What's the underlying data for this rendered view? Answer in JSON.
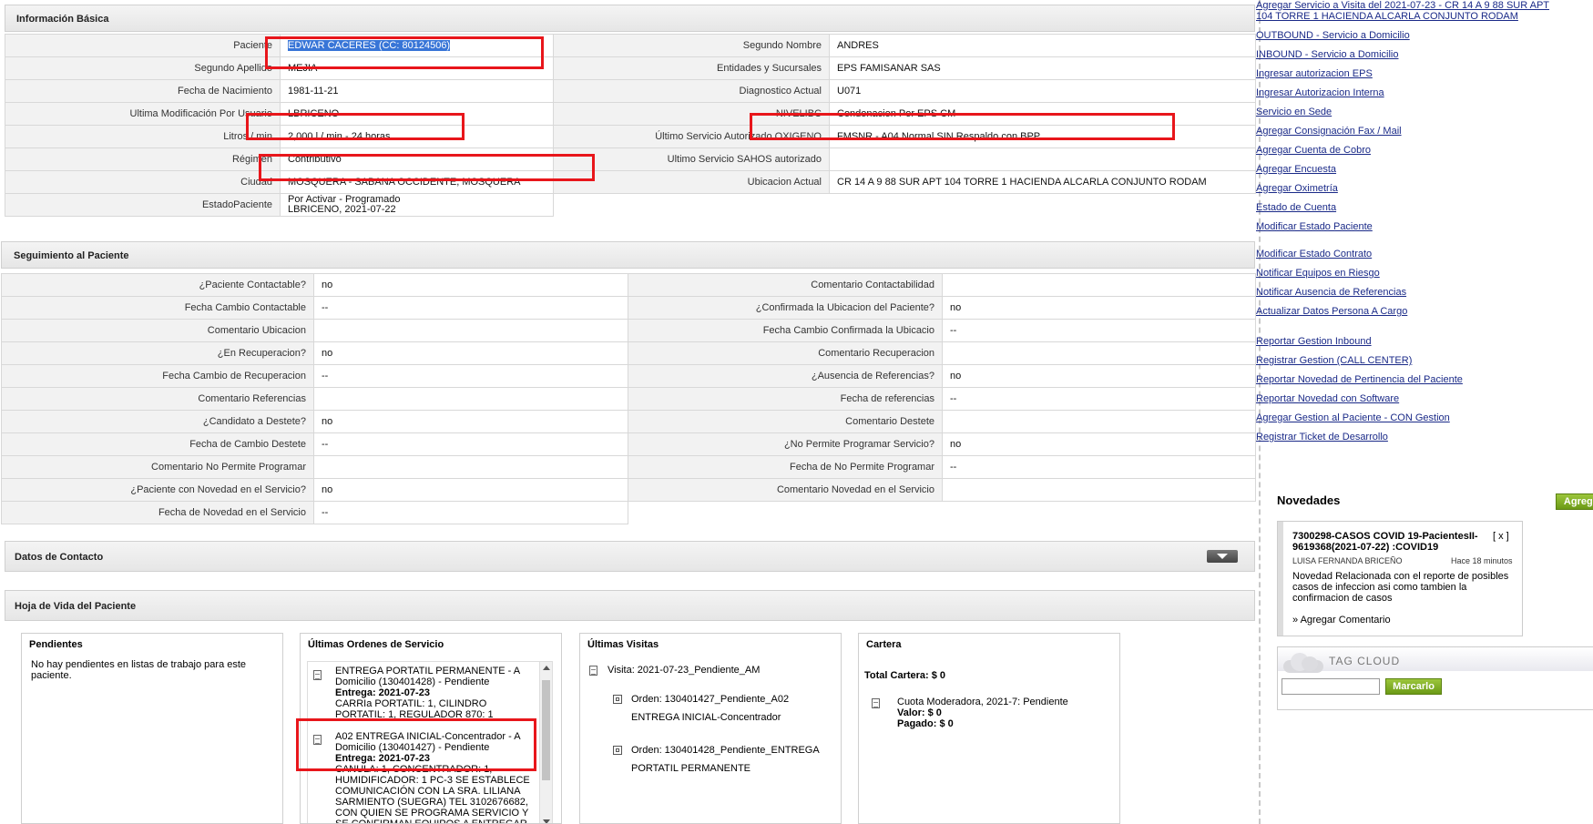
{
  "basic": {
    "header": "Información Básica",
    "rows": [
      {
        "l1": "Paciente",
        "v1": "EDWAR CACERES (CC: 80124506)",
        "l2": "Segundo Nombre",
        "v2": "ANDRES"
      },
      {
        "l1": "Segundo Apellido",
        "v1": "MEJIA",
        "l2": "Entidades y Sucursales",
        "v2": "EPS FAMISANAR SAS"
      },
      {
        "l1": "Fecha de Nacimiento",
        "v1": "1981-11-21",
        "l2": "Diagnostico Actual",
        "v2": "U071"
      },
      {
        "l1": "Ultima Modificación Por Usuario",
        "v1": "LBRICENO",
        "l2": "NIVELIBC",
        "v2": "Condonacion Por EPS CM"
      },
      {
        "l1": "Litros / min",
        "v1": "2,000 l / min - 24 horas",
        "l2": "Último Servicio Autorizado OXIGENO",
        "v2": "FMSNR - A04 Normal SIN Respaldo con BPP"
      },
      {
        "l1": "Régimen",
        "v1": "Contributivo",
        "l2": "Ultimo Servicio SAHOS autorizado",
        "v2": ""
      },
      {
        "l1": "Ciudad",
        "v1": "MOSQUERA - SABANA OCCIDENTE, MOSQUERA",
        "l2": "Ubicacion Actual",
        "v2": "CR 14 A 9 88 SUR APT 104 TORRE 1 HACIENDA ALCARLA CONJUNTO RODAM"
      }
    ],
    "estado_label": "EstadoPaciente",
    "estado_line1": "Por Activar - Programado",
    "estado_line2": "LBRICENO, 2021-07-22"
  },
  "seguimiento": {
    "header": "Seguimiento al Paciente",
    "rows": [
      {
        "l1": "¿Paciente Contactable?",
        "v1": "no",
        "l2": "Comentario Contactabilidad",
        "v2": ""
      },
      {
        "l1": "Fecha Cambio Contactable",
        "v1": "--",
        "l2": "¿Confirmada la Ubicacion del Paciente?",
        "v2": "no"
      },
      {
        "l1": "Comentario Ubicacion",
        "v1": "",
        "l2": "Fecha Cambio Confirmada la Ubicacio",
        "v2": "--"
      },
      {
        "l1": "¿En Recuperacion?",
        "v1": "no",
        "l2": "Comentario Recuperacion",
        "v2": ""
      },
      {
        "l1": "Fecha Cambio de Recuperacion",
        "v1": "--",
        "l2": "¿Ausencia de Referencias?",
        "v2": "no"
      },
      {
        "l1": "Comentario Referencias",
        "v1": "",
        "l2": "Fecha de referencias",
        "v2": "--"
      },
      {
        "l1": "¿Candidato a Destete?",
        "v1": "no",
        "l2": "Comentario Destete",
        "v2": ""
      },
      {
        "l1": "Fecha de Cambio Destete",
        "v1": "--",
        "l2": "¿No Permite Programar Servicio?",
        "v2": "no"
      },
      {
        "l1": "Comentario No Permite Programar",
        "v1": "",
        "l2": "Fecha de No Permite Programar",
        "v2": "--"
      },
      {
        "l1": "¿Paciente con Novedad en el Servicio?",
        "v1": "no",
        "l2": "Comentario Novedad en el Servicio",
        "v2": ""
      }
    ],
    "last_label": "Fecha de Novedad en el Servicio",
    "last_value": "--"
  },
  "contacto_header": "Datos de Contacto",
  "hoja_header": "Hoja de Vida del Paciente",
  "pendientes": {
    "title": "Pendientes",
    "text": "No hay pendientes en listas de trabajo para este paciente."
  },
  "ordenes": {
    "title": "Últimas Ordenes de Servicio",
    "items": [
      {
        "line1": "ENTREGA PORTATIL PERMANENTE - A Domicilio (130401428) - Pendiente",
        "entrega": "Entrega: 2021-07-23",
        "detail": "CARRIa PORTATIL: 1, CILINDRO PORTATIL: 1, REGULADOR 870: 1"
      },
      {
        "line1": "A02 ENTREGA INICIAL-Concentrador - A Domicilio (130401427) - Pendiente",
        "entrega": "Entrega: 2021-07-23",
        "detail": "CANULA: 1, CONCENTRADOR: 1, HUMIDIFICADOR: 1 PC-3 SE ESTABLECE COMUNICACIÓN CON LA SRA. LILIANA SARMIENTO (SUEGRA) TEL 3102676682, CON QUIEN SE PROGRAMA SERVICIO Y SE CONFIRMAN EQUIPOS A ENTREGAR"
      }
    ]
  },
  "visitas": {
    "title": "Últimas Visitas",
    "visita": "Visita: 2021-07-23_Pendiente_AM",
    "orden1": "Orden: 130401427_Pendiente_A02 ENTREGA INICIAL-Concentrador",
    "orden2": "Orden: 130401428_Pendiente_ENTREGA PORTATIL PERMANENTE"
  },
  "cartera": {
    "title": "Cartera",
    "total": "Total Cartera: $ 0",
    "cuota": "Cuota Moderadora, 2021-7: Pendiente",
    "valor": "Valor: $ 0",
    "pagado": "Pagado: $ 0"
  },
  "sidebar": {
    "links": [
      "Agregar Servicio a Visita del 2021-07-23 - CR 14 A 9 88 SUR APT 104 TORRE 1 HACIENDA ALCARLA CONJUNTO RODAM",
      "OUTBOUND - Servicio a Domicilio",
      "INBOUND - Servicio a Domicilio",
      "Ingresar autorizacion EPS",
      "Ingresar Autorizacion Interna",
      "Servicio en Sede",
      "Agregar Consignación Fax / Mail",
      "Agregar Cuenta de Cobro",
      "Agregar Encuesta",
      "Agregar Oximetría",
      "Estado de Cuenta",
      "Modificar Estado Paciente",
      "Modificar Estado Contrato",
      "Notificar Equipos en Riesgo",
      "Notificar Ausencia de Referencias",
      "Actualizar Datos Persona A Cargo",
      "Reportar Gestion Inbound",
      "Registrar Gestion (CALL CENTER)",
      "Reportar Novedad de Pertinencia del Paciente",
      "Reportar Novedad con Software",
      "Agregar Gestion al Paciente - CON Gestion",
      "Registrar Ticket de Desarrollo"
    ],
    "novedades_title": "Novedades",
    "agregar_label": "Agregar",
    "nov_title": "7300298-CASOS COVID 19-PacientesII-9619368(2021-07-22) :COVID19",
    "nov_close": "[ x ]",
    "nov_user": "LUISA FERNANDA BRICEÑO",
    "nov_time": "Hace 18 minutos",
    "nov_body": "Novedad Relacionada con el reporte de posibles casos de infeccion asi como tambien la confirmacion de casos",
    "nov_comment": "» Agregar Comentario",
    "tag_title": "TAG CLOUD",
    "tag_button": "Marcarlo",
    "tag_value": ""
  }
}
